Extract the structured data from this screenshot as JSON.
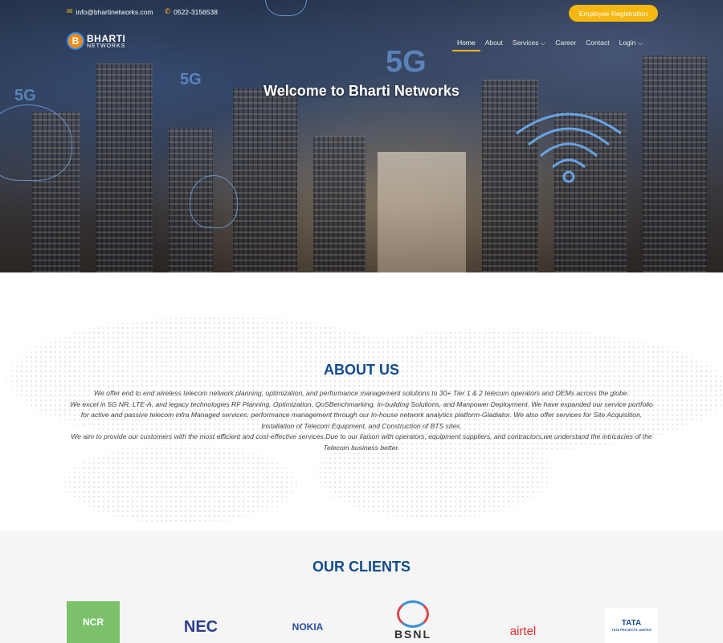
{
  "topbar": {
    "email": "info@bhartinetworks.com",
    "phone": "0522-3156538",
    "register_label": "Employee Registration"
  },
  "logo": {
    "mark": "B",
    "name": "BHARTI",
    "sub": "NETWORKS"
  },
  "nav": {
    "items": [
      {
        "label": "Home"
      },
      {
        "label": "About"
      },
      {
        "label": "Services ⌵"
      },
      {
        "label": "Career"
      },
      {
        "label": "Contact"
      },
      {
        "label": "Login ⌵"
      }
    ]
  },
  "hero": {
    "title": "Welcome to Bharti Networks",
    "badge": "5G"
  },
  "about": {
    "heading": "ABOUT US",
    "p1": "We offer end to end wireless telecom network planning, optimization, and performance management solutions to 30+ Tier 1 & 2 telecom operators and OEMs across the globe.",
    "p2": "We excel in 5G NR, LTE-A, and legacy technologies RF Planning, Optimization, QoSBenchmarking, In-building Solutions, and Manpower Deployment. We have expanded our service portfolio for active and passive telecom infra Managed services, performance management through our In-house network analytics platform-Gladiator. We also offer services for Site Acquisition, Installation of Telecom Equipment, and Construction of BTS sites.",
    "p3": "We aim to provide our customers with the most efficient and cost-effective services.Due to our liaison with operators, equipment suppliers, and contractors,we understand the intricacies of the Telecom business better."
  },
  "clients": {
    "heading": "OUR CLIENTS",
    "logos": [
      {
        "name": "NCR"
      },
      {
        "name": "NEC"
      },
      {
        "name": "NOKIA"
      },
      {
        "name": "BSNL"
      },
      {
        "name": "airtel"
      },
      {
        "name": "TATA",
        "sub": "TATA PROJECTS LIMITED"
      }
    ]
  },
  "colors": {
    "accent": "#f5b80f",
    "heading": "#124c8a"
  }
}
